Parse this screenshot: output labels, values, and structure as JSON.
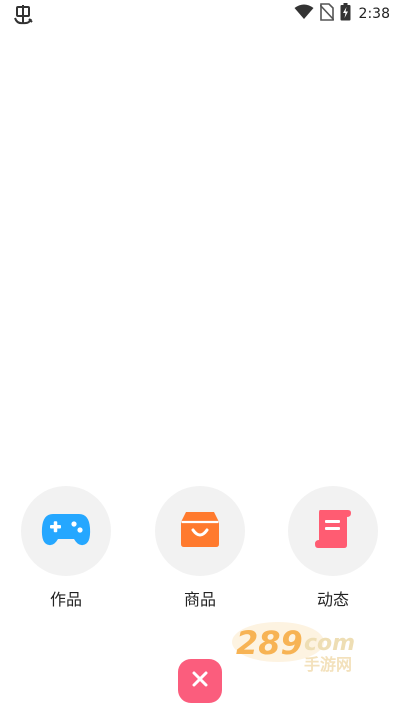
{
  "status_bar": {
    "left_icon": "bug-notification-icon",
    "wifi_icon": "wifi-icon",
    "sim_icon": "no-sim-icon",
    "battery_icon": "battery-charging-icon",
    "time": "2:38"
  },
  "actions": [
    {
      "label": "作品",
      "icon": "gamepad-icon",
      "color": "#25a7ff"
    },
    {
      "label": "商品",
      "icon": "shopping-bag-icon",
      "color": "#ff7a2e"
    },
    {
      "label": "动态",
      "icon": "scroll-document-icon",
      "color": "#ff5c72"
    }
  ],
  "close_button": {
    "icon": "close-icon",
    "color": "#fb5d7d"
  },
  "watermark": {
    "icon": "289-com-watermark-logo",
    "text": "289com手游网"
  }
}
